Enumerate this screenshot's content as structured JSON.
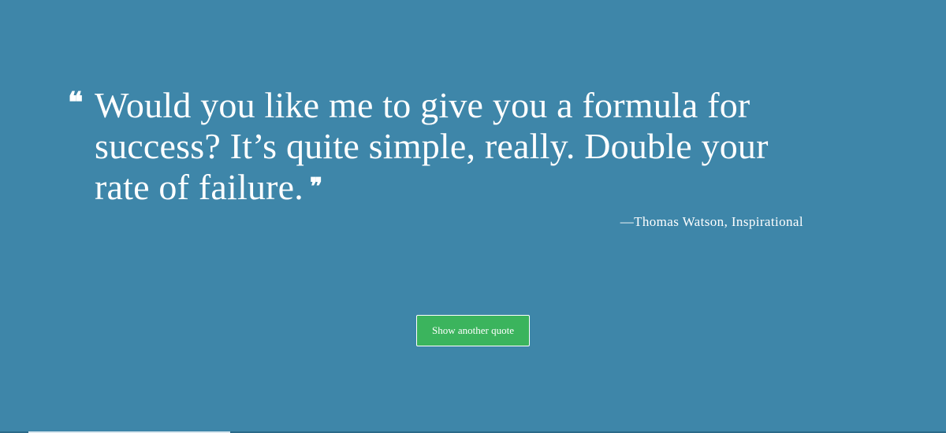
{
  "quote": {
    "open_mark": "❝",
    "text": "Would you like me to give you a formula for success? It’s quite simple, really. Double your rate of failure.",
    "close_mark": "❞",
    "attribution": "—Thomas Watson, Inspirational"
  },
  "actions": {
    "another_quote_label": "Show another quote"
  },
  "colors": {
    "background": "#3e86a9",
    "button": "#3bb45d",
    "text": "#ffffff"
  }
}
